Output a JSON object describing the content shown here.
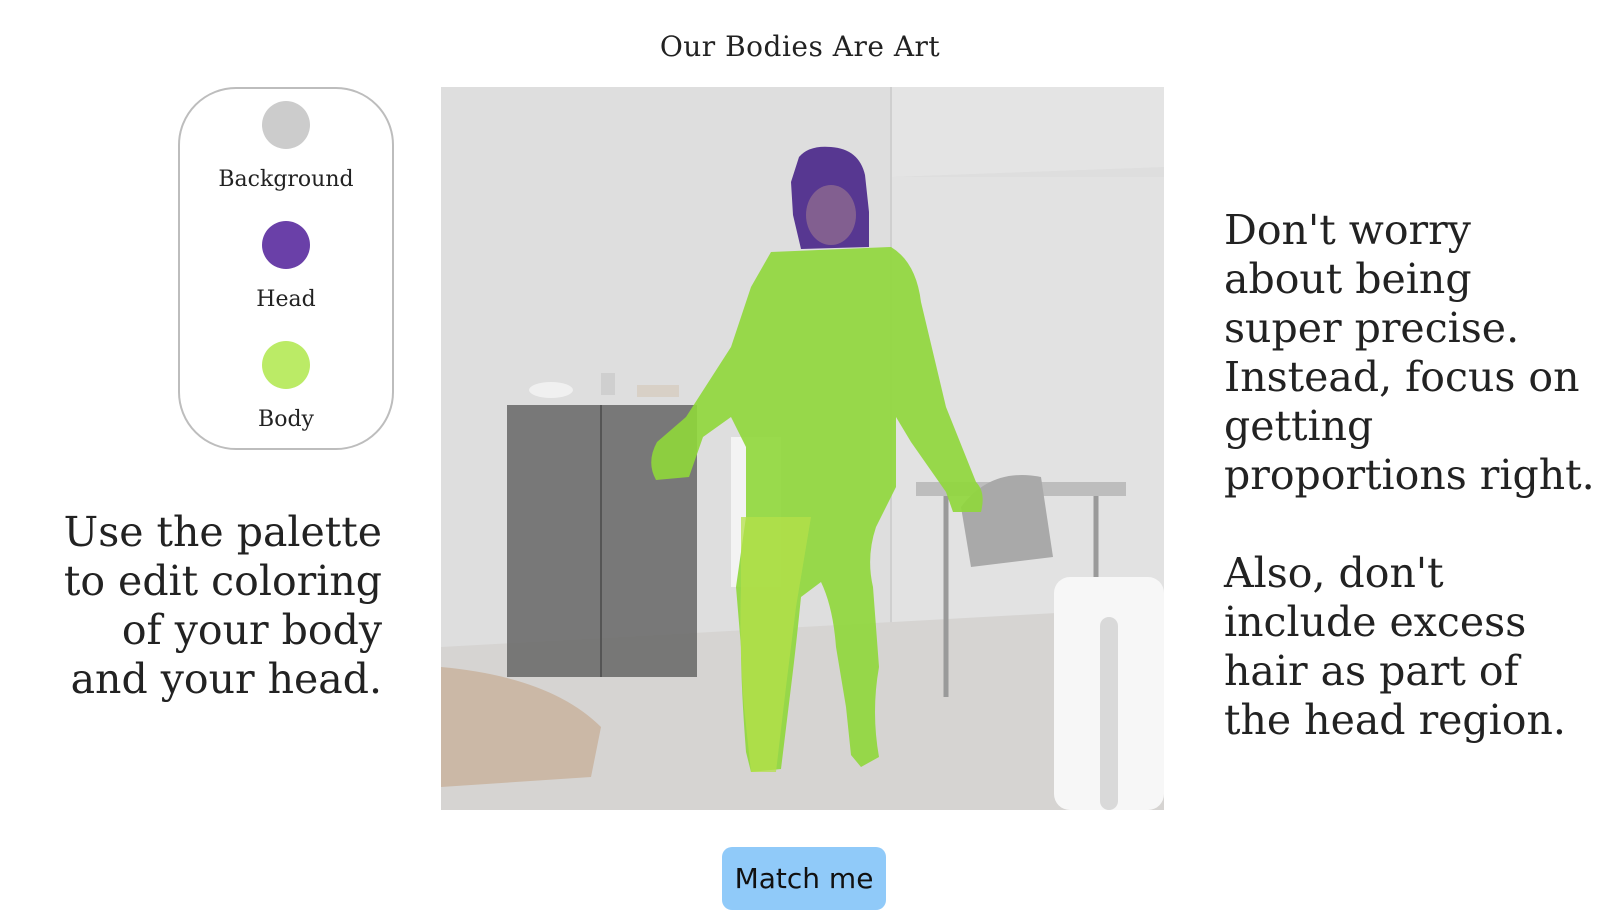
{
  "page": {
    "title": "Our Bodies Are Art"
  },
  "palette": {
    "items": [
      {
        "label": "Background",
        "color": "#cccccc"
      },
      {
        "label": "Head",
        "color": "#6a40a8"
      },
      {
        "label": "Body",
        "color": "#bbeb66"
      }
    ]
  },
  "instructions": {
    "left": "Use the palette to edit coloring of your body and your head.",
    "right_1": "Don't worry about being super precise. Instead, focus on getting proportions right.",
    "right_2": "Also, don't include excess hair as part of the head region."
  },
  "overlay": {
    "head_color": "#4f2d8c",
    "body_color": "#8fd73a",
    "background_tint": "#e6e6e6"
  },
  "actions": {
    "match_label": "Match me"
  }
}
